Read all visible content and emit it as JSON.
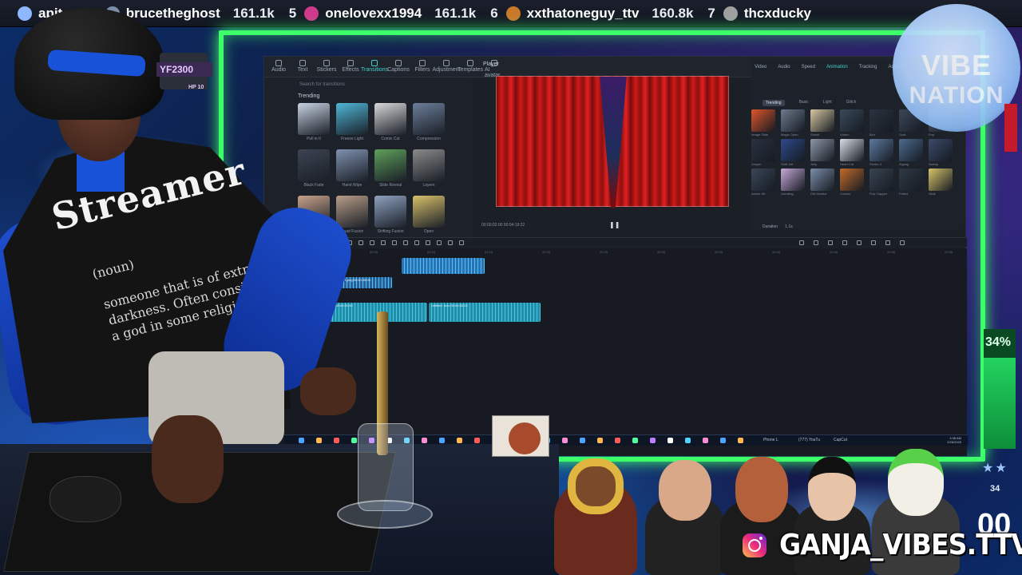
{
  "ticker": {
    "items": [
      {
        "rank": "",
        "name": "apit",
        "count": "",
        "avatar_color": "#8fb7ff"
      },
      {
        "rank": "4",
        "name": "brucetheghost",
        "count": "161.1k",
        "avatar_color": "#7d8fa8"
      },
      {
        "rank": "5",
        "name": "onelovexx1994",
        "count": "161.1k",
        "avatar_color": "#d03a8c"
      },
      {
        "rank": "6",
        "name": "xxthatoneguy_ttv",
        "count": "160.8k",
        "avatar_color": "#c87a2a"
      },
      {
        "rank": "7",
        "name": "thcxducky",
        "count": "",
        "avatar_color": "#a0a0a0"
      }
    ]
  },
  "overlay": {
    "game_tag": "YF2300",
    "hp_tag": "HP 10",
    "logo_line1": "VIBE",
    "logo_line2": "NATION",
    "progress_percent": "34%",
    "progress_fraction": 0.34,
    "side_count": "34",
    "side_big": "00",
    "side_stars": "★★",
    "social_handle": "GANJA_VIBES.TTV",
    "accent_green": "#3dff6a"
  },
  "streamer": {
    "shirt_title": "Streamer",
    "shirt_lines": [
      "(noun)",
      "someone that is of extreme",
      "darkness. Often considered",
      "a god in some religions."
    ]
  },
  "editor": {
    "top_tabs": [
      "Audio",
      "Text",
      "Stickers",
      "Effects",
      "Transitions",
      "Captions",
      "Filters",
      "Adjustment",
      "Templates",
      "AI avatar"
    ],
    "active_tab": "Transitions",
    "search_placeholder": "Search for transitions",
    "section_label": "Trending",
    "transitions": [
      {
        "label": "Pull in II",
        "color": "#c9d3e3"
      },
      {
        "label": "Freeze Light",
        "color": "#4fb7d8"
      },
      {
        "label": "Comic Cut",
        "color": "#d9d9d9"
      },
      {
        "label": "Compression",
        "color": "#6d7e9a"
      },
      {
        "label": "Black Fade",
        "color": "#3d4452"
      },
      {
        "label": "Hand Wipe",
        "color": "#7f92b0"
      },
      {
        "label": "Slide Reveal",
        "color": "#5ea05a"
      },
      {
        "label": "Layers",
        "color": "#8a8a8a"
      },
      {
        "label": "Blurred Portal",
        "color": "#c8a28a"
      },
      {
        "label": "Quad Fusion",
        "color": "#b89d88"
      },
      {
        "label": "Shifting Fusion",
        "color": "#8fa2c0"
      },
      {
        "label": "Open",
        "color": "#d8c06a"
      }
    ],
    "player_title": "Player",
    "player_time": "00:00:02:00  00:04:19:22",
    "play_icon": "pause-icon",
    "prop_tabs": [
      "Video",
      "Audio",
      "Speed",
      "Animation",
      "Tracking",
      "Adjust"
    ],
    "prop_active": "Animation",
    "prop_sub_tabs": [
      "In",
      "Out"
    ],
    "prop_filter_tabs": [
      "Trending",
      "Basic",
      "Light",
      "Glitch"
    ],
    "animations": [
      {
        "label": "Image Slide",
        "color": "#e0552a"
      },
      {
        "label": "Magic Open",
        "color": "#6c7a8e"
      },
      {
        "label": "Shrink",
        "color": "#d8c8a0"
      },
      {
        "label": "Vortex",
        "color": "#3a4a5a"
      },
      {
        "label": "Blur",
        "color": "#2a3440"
      },
      {
        "label": "Gust",
        "color": "#3b4758"
      },
      {
        "label": "Pop",
        "color": "#4a5668"
      },
      {
        "label": "Unspin",
        "color": "#2a3140"
      },
      {
        "label": "Shift Jolt",
        "color": "#2e4a8a"
      },
      {
        "label": "Jelly",
        "color": "#8e98a8"
      },
      {
        "label": "Heart Cut",
        "color": "#d8dde6"
      },
      {
        "label": "Stroke 3",
        "color": "#5d7aa0"
      },
      {
        "label": "Zigzag",
        "color": "#4c6a8e"
      },
      {
        "label": "Sweep",
        "color": "#3a4a6a"
      },
      {
        "label": "Anime Hit",
        "color": "#3a4658"
      },
      {
        "label": "Unrolling",
        "color": "#c7a9d8"
      },
      {
        "label": "Old Monitor",
        "color": "#7a8ea8"
      },
      {
        "label": "Cosmic",
        "color": "#c26a2a"
      },
      {
        "label": "Pop Clapper",
        "color": "#3a4552"
      },
      {
        "label": "Pulled",
        "color": "#2f3946"
      },
      {
        "label": "Slide",
        "color": "#d8c36a"
      }
    ],
    "duration_label": "Duration",
    "duration_value": "1.1s",
    "ruler_marks": [
      "00:00",
      "00:05",
      "00:10",
      "00:15",
      "00:20",
      "00:25",
      "00:30",
      "00:35",
      "00:40",
      "00:45",
      "00:50",
      "00:55"
    ],
    "clips": [
      {
        "label": "",
        "color": "#2a72b8"
      },
      {
        "label": "gettin in the studio 1.png  00:00:05:00",
        "color": "#2a5f9e"
      },
      {
        "label": "Untitled .mov  00:00:21:00",
        "color": "#1f8fa8"
      },
      {
        "label": "Untitled .mov  00:00:33:22",
        "color": "#1f8fa8"
      }
    ],
    "taskbar_time": "4:38 AM",
    "taskbar_date": "2/28/2025",
    "taskbar_labels": [
      "Phone L",
      "(777) YouTu",
      "CapCut"
    ]
  }
}
